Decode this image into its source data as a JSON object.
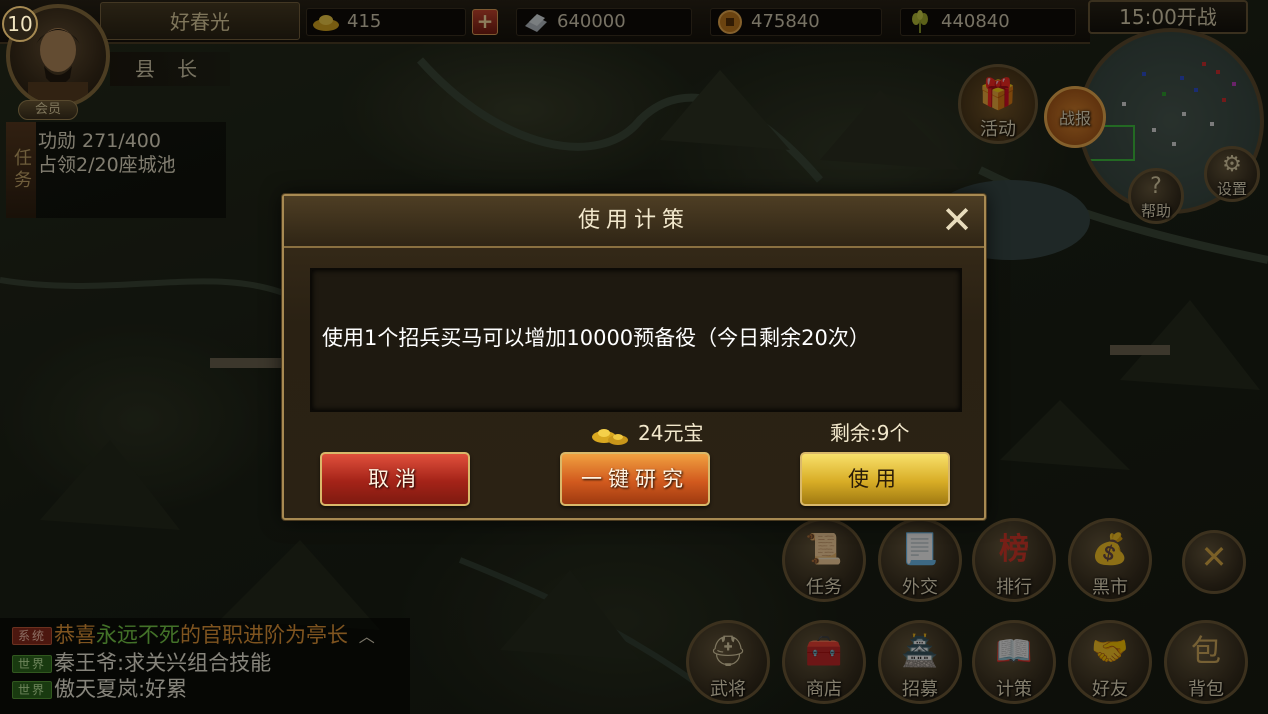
{
  "player": {
    "level": "10",
    "name": "好春光",
    "title": "县 长",
    "vip_label": "会员"
  },
  "resources": {
    "gold": "415",
    "add_label": "+",
    "silver": "640000",
    "copper": "475840",
    "grain": "440840"
  },
  "timer": "15:00开战",
  "quest": {
    "tab_label": "任务",
    "line1": "功勋 271/400",
    "line2": "占领2/20座城池"
  },
  "side_buttons": {
    "activity": "活动",
    "battle": "战报",
    "help": "帮助",
    "settings": "设置"
  },
  "dialog": {
    "title": "使用计策",
    "close_icon": "✕",
    "message": "使用1个招兵买马可以增加10000预备役（今日剩余20次）",
    "cost": "24元宝",
    "remaining": "剩余:9个",
    "cancel_label": "取消",
    "research_label": "一键研究",
    "use_label": "使用"
  },
  "bottom_menu": {
    "row1": [
      "任务",
      "外交",
      "排行",
      "黑市"
    ],
    "row2": [
      "武将",
      "商店",
      "招募",
      "计策",
      "好友",
      "背包"
    ],
    "close_icon": "✕"
  },
  "chat": {
    "line1_tag": "系统",
    "line1_pre": "恭喜",
    "line1_name": "永远不死",
    "line1_mid": "的官职进阶为",
    "line1_rank": "亭长",
    "line2_tag": "世界",
    "line2_text": "秦王爷:求关兴组合技能",
    "line3_tag": "世界",
    "line3_text": "傲天夏岚:好累"
  },
  "colors": {
    "accent_gold": "#d9b86a",
    "cancel_red": "#a42318",
    "research_orange": "#d25a1e",
    "use_gold": "#d8ad26",
    "chat_highlight_green": "#7ad04a",
    "chat_highlight_orange": "#e89a3a"
  }
}
